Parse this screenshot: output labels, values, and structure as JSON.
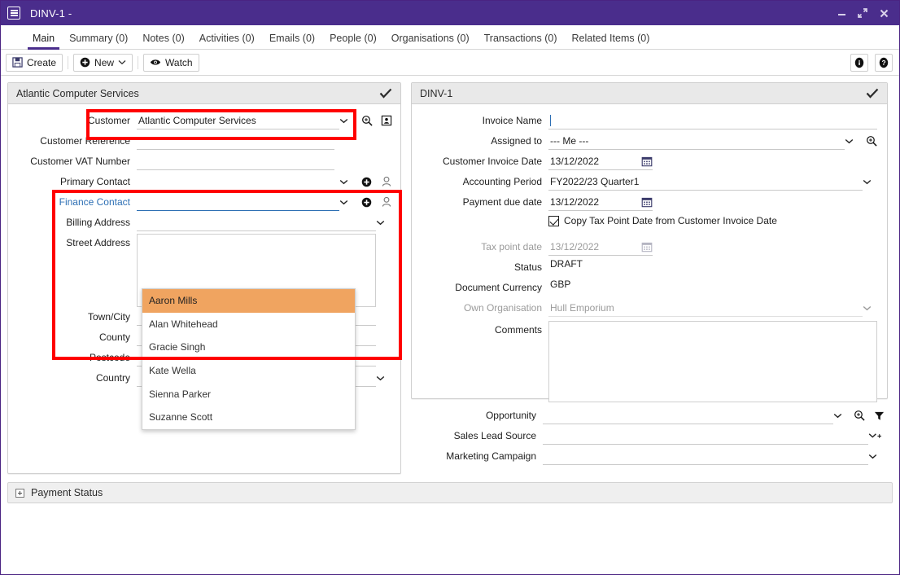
{
  "window": {
    "title": "DINV-1 -",
    "icon": "document-icon",
    "minimize": "minimize-icon",
    "maximize": "maximize-icon",
    "close": "close-icon"
  },
  "tabs": [
    {
      "label": "Main",
      "active": true
    },
    {
      "label": "Summary (0)",
      "active": false
    },
    {
      "label": "Notes (0)",
      "active": false
    },
    {
      "label": "Activities (0)",
      "active": false
    },
    {
      "label": "Emails (0)",
      "active": false
    },
    {
      "label": "People (0)",
      "active": false
    },
    {
      "label": "Organisations (0)",
      "active": false
    },
    {
      "label": "Transactions (0)",
      "active": false
    },
    {
      "label": "Related Items (0)",
      "active": false
    }
  ],
  "toolbar": {
    "create_label": "Create",
    "new_label": "New",
    "watch_label": "Watch",
    "info_icon": "info-icon",
    "help_icon": "help-icon"
  },
  "left_panel": {
    "header": "Atlantic Computer Services",
    "fields": {
      "customer_label": "Customer",
      "customer_value": "Atlantic Computer Services",
      "customer_reference_label": "Customer Reference",
      "customer_reference_value": "",
      "customer_vat_label": "Customer VAT Number",
      "customer_vat_value": "",
      "primary_contact_label": "Primary Contact",
      "primary_contact_value": "",
      "finance_contact_label": "Finance Contact",
      "finance_contact_value": "",
      "billing_address_label": "Billing Address",
      "billing_address_value": "",
      "street_address_label": "Street Address",
      "street_address_value": "",
      "town_city_label": "Town/City",
      "town_city_value": "",
      "county_label": "County",
      "county_value": "",
      "postcode_label": "Postcode",
      "postcode_value": "",
      "country_label": "Country",
      "country_value": ""
    }
  },
  "finance_contact_dropdown": {
    "options": [
      "Aaron Mills",
      "Alan Whitehead",
      "Gracie Singh",
      "Kate Wella",
      "Sienna Parker",
      "Suzanne Scott"
    ],
    "selected": "Aaron Mills"
  },
  "right_panel": {
    "header": "DINV-1",
    "fields": {
      "invoice_name_label": "Invoice Name",
      "invoice_name_value": "",
      "assigned_to_label": "Assigned to",
      "assigned_to_value": "--- Me ---",
      "customer_invoice_date_label": "Customer Invoice Date",
      "customer_invoice_date_value": "13/12/2022",
      "accounting_period_label": "Accounting Period",
      "accounting_period_value": "FY2022/23 Quarter1",
      "payment_due_date_label": "Payment due date",
      "payment_due_date_value": "13/12/2022",
      "copy_tax_point_label": "Copy Tax Point Date from Customer Invoice Date",
      "copy_tax_point_checked": true,
      "tax_point_date_label": "Tax point date",
      "tax_point_date_value": "13/12/2022",
      "status_label": "Status",
      "status_value": "DRAFT",
      "document_currency_label": "Document Currency",
      "document_currency_value": "GBP",
      "own_organisation_label": "Own Organisation",
      "own_organisation_value": "Hull Emporium",
      "comments_label": "Comments",
      "comments_value": ""
    }
  },
  "right_subform": {
    "opportunity_label": "Opportunity",
    "opportunity_value": "",
    "sales_lead_source_label": "Sales Lead Source",
    "sales_lead_source_value": "",
    "marketing_campaign_label": "Marketing Campaign",
    "marketing_campaign_value": ""
  },
  "payment_status": {
    "label": "Payment Status"
  },
  "colors": {
    "titlebar": "#4a2d8c",
    "accent": "#4a2d8c",
    "highlight_box": "#ff0000",
    "dropdown_selected": "#f0a460",
    "panel_header": "#e9e9e9",
    "link_label": "#2d6fb4"
  }
}
